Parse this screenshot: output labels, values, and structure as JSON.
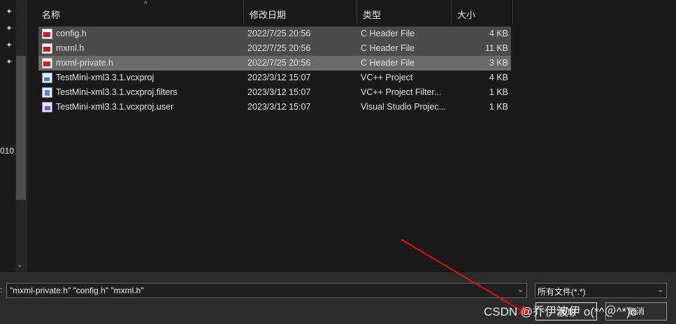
{
  "sidebar": {
    "pins": [
      "pin-icon",
      "pin-icon",
      "pin-icon",
      "pin-icon"
    ],
    "partial_text": "010",
    "scroll_down_glyph": "⌄"
  },
  "columns": {
    "name": "名称",
    "date": "修改日期",
    "type": "类型",
    "size": "大小",
    "sort_glyph": "^"
  },
  "files": [
    {
      "name": "config.h",
      "date": "2022/7/25 20:56",
      "type": "C Header File",
      "size": "4 KB",
      "icon": "c-header-file-icon",
      "selected": true,
      "focused": false
    },
    {
      "name": "mxml.h",
      "date": "2022/7/25 20:56",
      "type": "C Header File",
      "size": "11 KB",
      "icon": "c-header-file-icon",
      "selected": true,
      "focused": false
    },
    {
      "name": "mxml-private.h",
      "date": "2022/7/25 20:56",
      "type": "C Header File",
      "size": "3 KB",
      "icon": "c-header-file-icon",
      "selected": true,
      "focused": true
    },
    {
      "name": "TestMini-xml3.3.1.vcxproj",
      "date": "2023/3/12 15:07",
      "type": "VC++ Project",
      "size": "4 KB",
      "icon": "vcxproj-file-icon",
      "selected": false,
      "focused": false
    },
    {
      "name": "TestMini-xml3.3.1.vcxproj.filters",
      "date": "2023/3/12 15:07",
      "type": "VC++ Project Filter...",
      "size": "1 KB",
      "icon": "filters-file-icon",
      "selected": false,
      "focused": false
    },
    {
      "name": "TestMini-xml3.3.1.vcxproj.user",
      "date": "2023/3/12 15:07",
      "type": "Visual Studio Projec...",
      "size": "1 KB",
      "icon": "user-file-icon",
      "selected": false,
      "focused": false
    }
  ],
  "footer": {
    "filename_label": ":",
    "filename_value": "\"mxml-private.h\" \"config.h\" \"mxml.h\"",
    "filetype_value": "所有文件(*.*)",
    "dropdown_glyph": "⌄",
    "open_label": "添加(",
    "cancel_label": "取消"
  },
  "watermark": "CSDN @乔伊波伊 o(*^＠^*)o",
  "colors": {
    "background": "#1e1e1e",
    "selection": "#4b4b4b",
    "focus_selection": "#6a6a6a",
    "arrow": "#e01010"
  }
}
